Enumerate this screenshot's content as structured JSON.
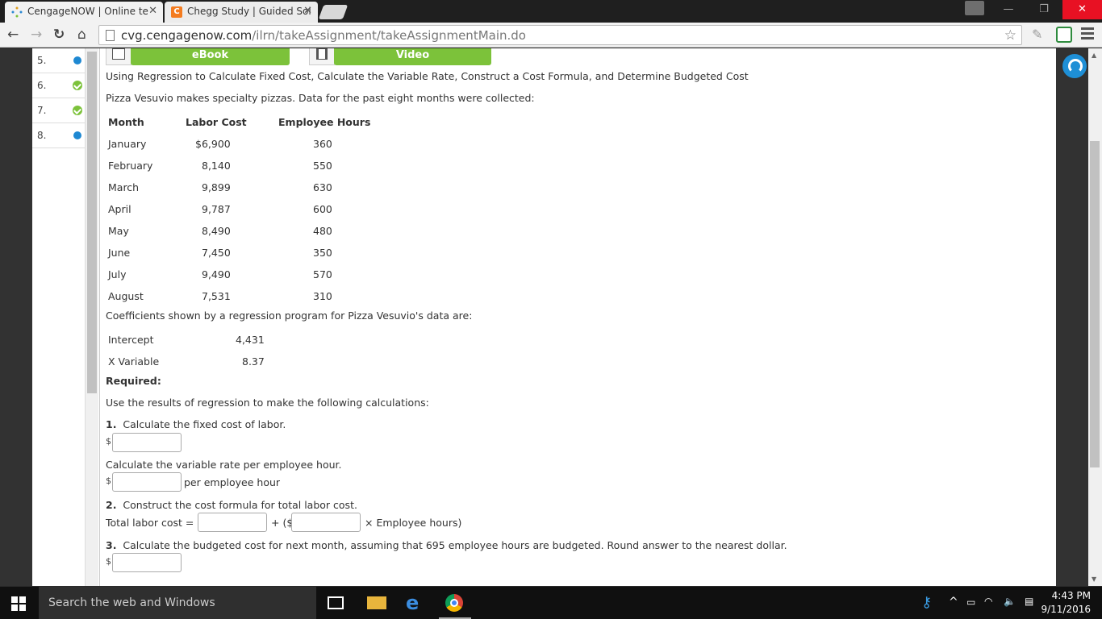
{
  "browser": {
    "tabs": [
      {
        "title": "CengageNOW | Online te",
        "active": true
      },
      {
        "title": "Chegg Study | Guided Sol",
        "active": false
      }
    ],
    "url_host": "cvg.cengagenow.com",
    "url_path": "/ilrn/takeAssignment/takeAssignmentMain.do",
    "window_controls": {
      "minimize": "—",
      "restore": "❐",
      "close": "✕"
    }
  },
  "question_nav": [
    {
      "num": "5.",
      "status": "dot"
    },
    {
      "num": "6.",
      "status": "check"
    },
    {
      "num": "7.",
      "status": "check"
    },
    {
      "num": "8.",
      "status": "dot"
    }
  ],
  "resources": {
    "ebook": "eBook",
    "video": "Video"
  },
  "problem": {
    "title": "Using Regression to Calculate Fixed Cost, Calculate the Variable Rate, Construct a Cost Formula, and Determine Budgeted Cost",
    "intro": "Pizza Vesuvio makes specialty pizzas. Data for the past eight months were collected:",
    "table": {
      "headers": [
        "Month",
        "Labor Cost",
        "Employee Hours"
      ],
      "rows": [
        [
          "January",
          "$6,900",
          "360"
        ],
        [
          "February",
          "8,140",
          "550"
        ],
        [
          "March",
          "9,899",
          "630"
        ],
        [
          "April",
          "9,787",
          "600"
        ],
        [
          "May",
          "8,490",
          "480"
        ],
        [
          "June",
          "7,450",
          "350"
        ],
        [
          "July",
          "9,490",
          "570"
        ],
        [
          "August",
          "7,531",
          "310"
        ]
      ]
    },
    "coef_intro": "Coefficients shown by a regression program for Pizza Vesuvio's data are:",
    "coefficients": [
      [
        "Intercept",
        "4,431"
      ],
      [
        "X Variable",
        "8.37"
      ]
    ],
    "required": "Required:",
    "instruction": "Use the results of regression to make the following calculations:",
    "q1_num": "1.",
    "q1": "Calculate the fixed cost of labor.",
    "q1b": "Calculate the variable rate per employee hour.",
    "per_hour": "per employee hour",
    "q2_num": "2.",
    "q2": "Construct the cost formula for total labor cost.",
    "formula_label": "Total labor cost = $",
    "formula_plus": "+ ($",
    "formula_times": "× Employee hours)",
    "q3_num": "3.",
    "q3": "Calculate the budgeted cost for next month, assuming that 695 employee hours are budgeted. Round answer to the nearest dollar.",
    "dollar": "$"
  },
  "taskbar": {
    "search_placeholder": "Search the web and Windows",
    "time": "4:43 PM",
    "date": "9/11/2016"
  },
  "colors": {
    "accent_green": "#7cc23a",
    "accent_blue": "#1e88d2",
    "close_red": "#e81123"
  }
}
